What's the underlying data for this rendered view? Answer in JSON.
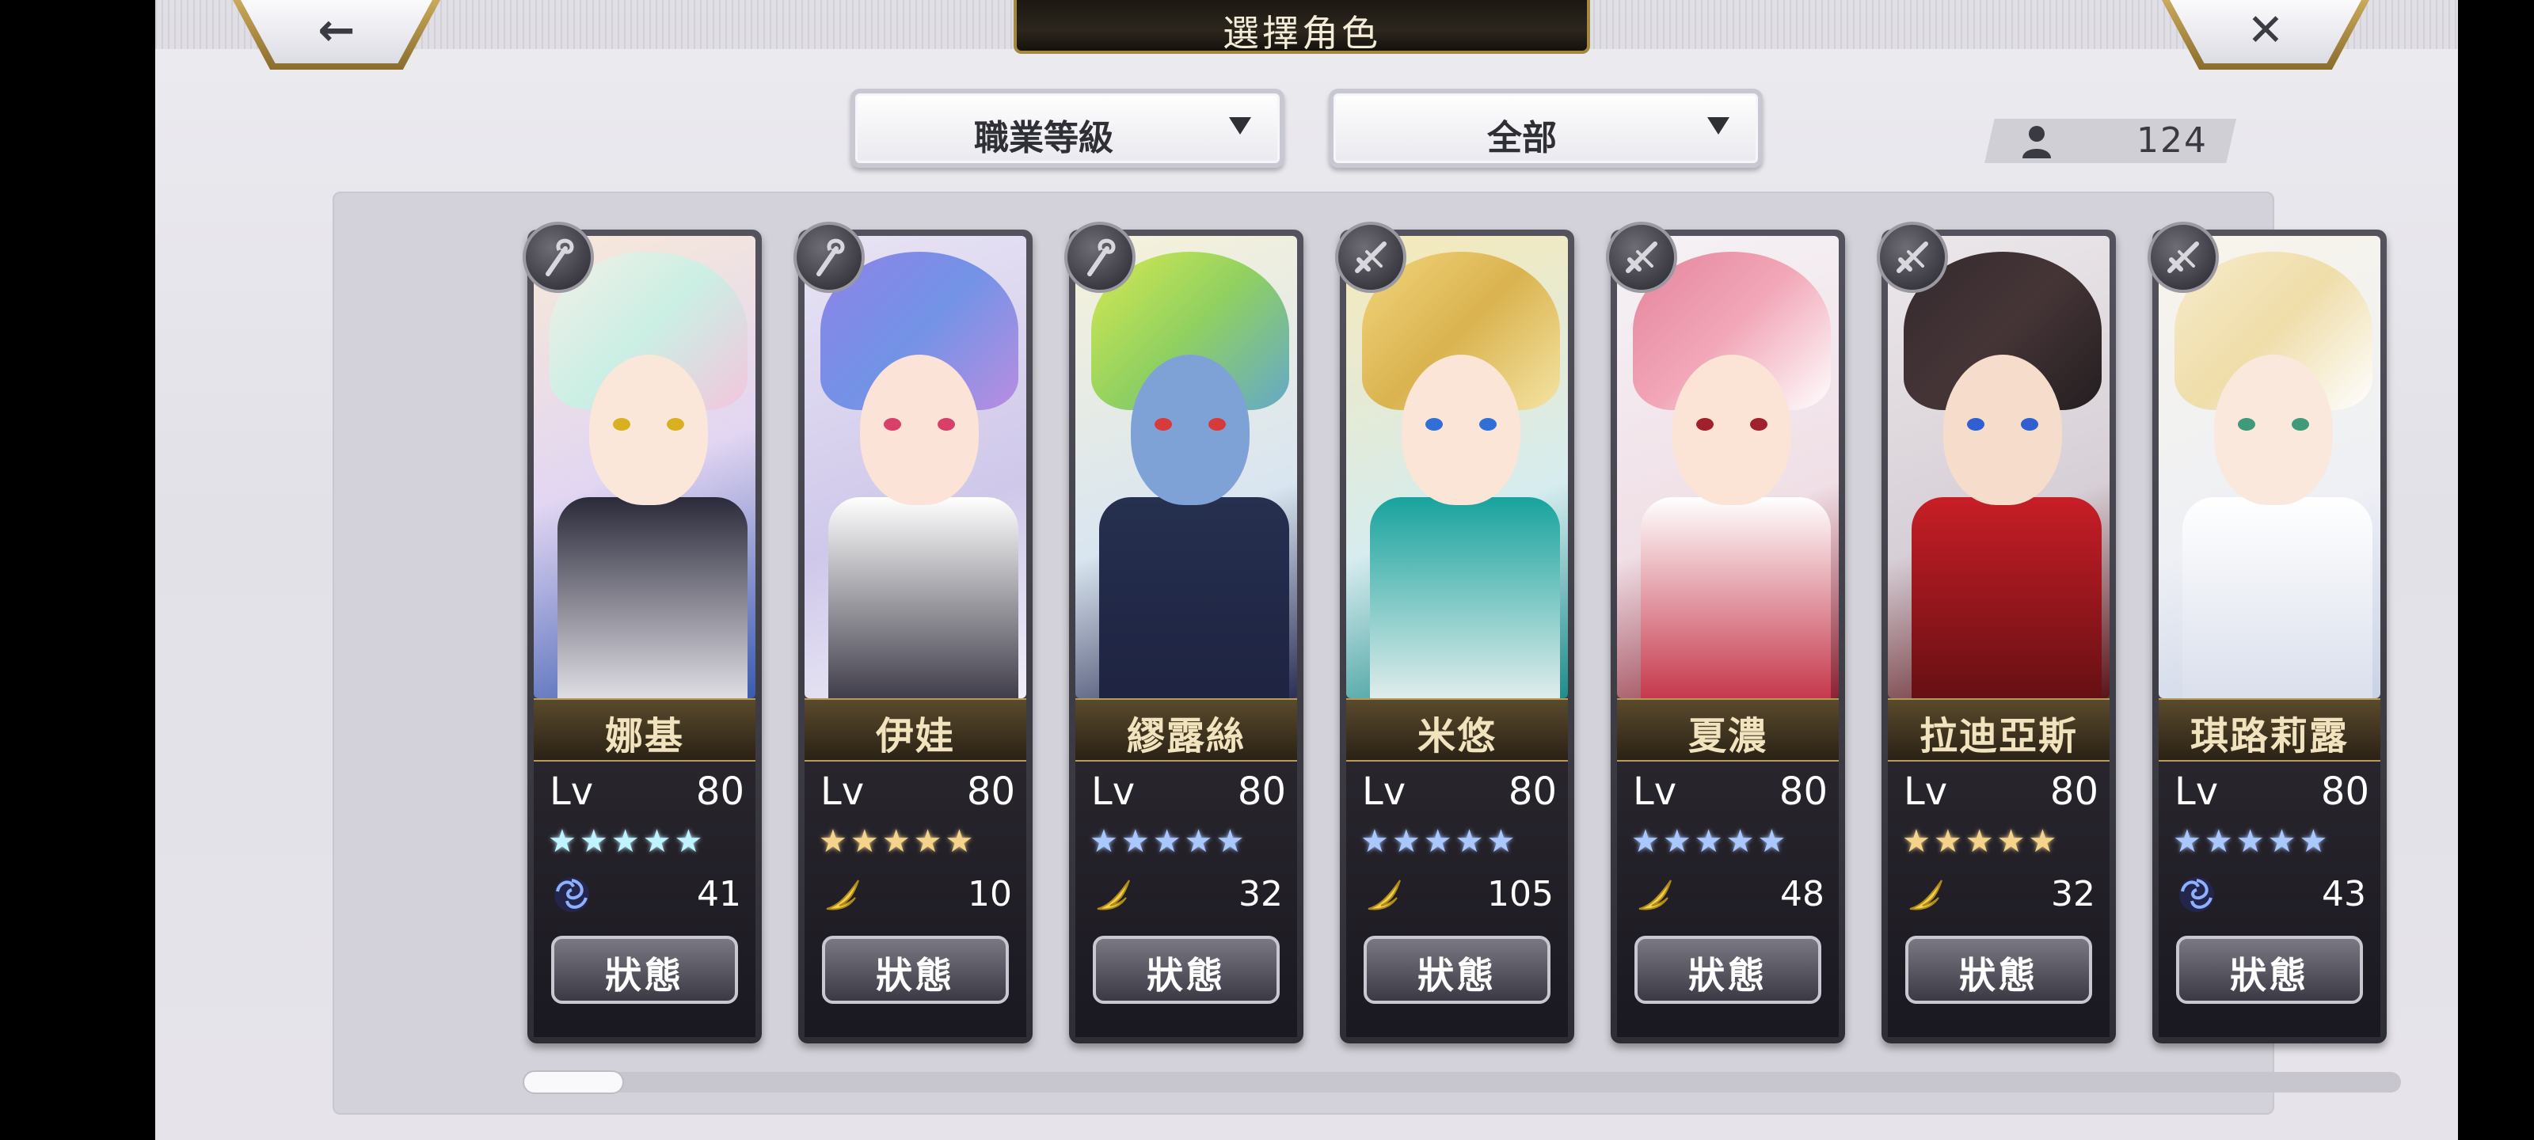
{
  "header": {
    "title": "選擇角色",
    "back_icon": "back-arrow-icon",
    "close_icon": "close-icon"
  },
  "filters": {
    "sort_label": "職業等級",
    "filter_label": "全部"
  },
  "count": {
    "icon": "person-icon",
    "value": "124"
  },
  "status_label": "狀態",
  "lv_label": "Lv",
  "characters": [
    {
      "name": "娜基",
      "level": "80",
      "stars": "★★★★★",
      "power": "41",
      "class_icon": "staff-icon",
      "element_icon": "vortex-icon",
      "star_color": "#bff3ff"
    },
    {
      "name": "伊娃",
      "level": "80",
      "stars": "★★★★★",
      "power": "10",
      "class_icon": "staff-icon",
      "element_icon": "wing-icon",
      "star_color": "#f3d48a"
    },
    {
      "name": "繆露絲",
      "level": "80",
      "stars": "★★★★★",
      "power": "32",
      "class_icon": "staff-icon",
      "element_icon": "wing-icon",
      "star_color": "#a9c8ff"
    },
    {
      "name": "米悠",
      "level": "80",
      "stars": "★★★★★",
      "power": "105",
      "class_icon": "sword-icon",
      "element_icon": "wing-icon",
      "star_color": "#a9c8ff"
    },
    {
      "name": "夏濃",
      "level": "80",
      "stars": "★★★★★",
      "power": "48",
      "class_icon": "sword-icon",
      "element_icon": "wing-icon",
      "star_color": "#a9c8ff"
    },
    {
      "name": "拉迪亞斯",
      "level": "80",
      "stars": "★★★★★",
      "power": "32",
      "class_icon": "sword-icon",
      "element_icon": "wing-icon",
      "star_color": "#f3d48a"
    },
    {
      "name": "琪路莉露",
      "level": "80",
      "stars": "★★★★★",
      "power": "43",
      "class_icon": "sword-icon",
      "element_icon": "vortex-icon",
      "star_color": "#a9c8ff"
    }
  ]
}
